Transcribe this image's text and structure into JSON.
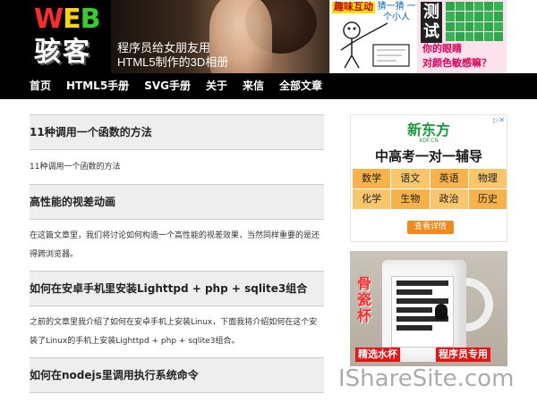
{
  "header": {
    "logo_text": [
      "W",
      "E",
      "B"
    ],
    "logo_han": "骇客",
    "banner": {
      "line1": "程序员给女朋友用",
      "line2": "HTML5制作的3D相册"
    },
    "ad_cartoon": {
      "tag1": "趣味互动",
      "tag2": "猜一猜 一个小人"
    },
    "ad_test": {
      "big": "测试",
      "line1": "你的眼睛",
      "line2": "对颜色敏感嘛？"
    }
  },
  "nav": {
    "items": [
      "首页",
      "HTML5手册",
      "SVG手册",
      "关于",
      "来信",
      "全部文章"
    ]
  },
  "posts": [
    {
      "title": "11种调用一个函数的方法",
      "excerpt": "11种调用一个函数的方法"
    },
    {
      "title": "高性能的视差动画",
      "excerpt": "在这篇文章里，我们将讨论如何构造一个高性能的视差效果，当然同样重要的是还得跨浏览器。"
    },
    {
      "title": "如何在安卓手机里安装Lighttpd + php + sqlite3组合",
      "excerpt": "之前的文章里我介绍了如何在安卓手机上安装Linux，下面我将介绍如何在这个安装了Linux的手机上安装Lighttpd + php + sqlite3组合。"
    },
    {
      "title": "如何在nodejs里调用执行系统命令",
      "excerpt": ""
    }
  ],
  "sidebar": {
    "ad1": {
      "brand": "新东方",
      "brand_sub": "XDF.CN",
      "headline": "中高考一对一辅导",
      "subjects": [
        "数学",
        "语文",
        "英语",
        "物理",
        "化学",
        "生物",
        "政治",
        "历史"
      ],
      "cta": "查看详情"
    },
    "ad2": {
      "label1": "骨瓷杯",
      "label2": "精选水杯",
      "label3": "程序员专用"
    }
  },
  "watermark": "IShareSite.com",
  "colors": {
    "nav_bg": "#000000",
    "title_bg": "#eeeeee",
    "accent_orange": "#f7b34a"
  }
}
